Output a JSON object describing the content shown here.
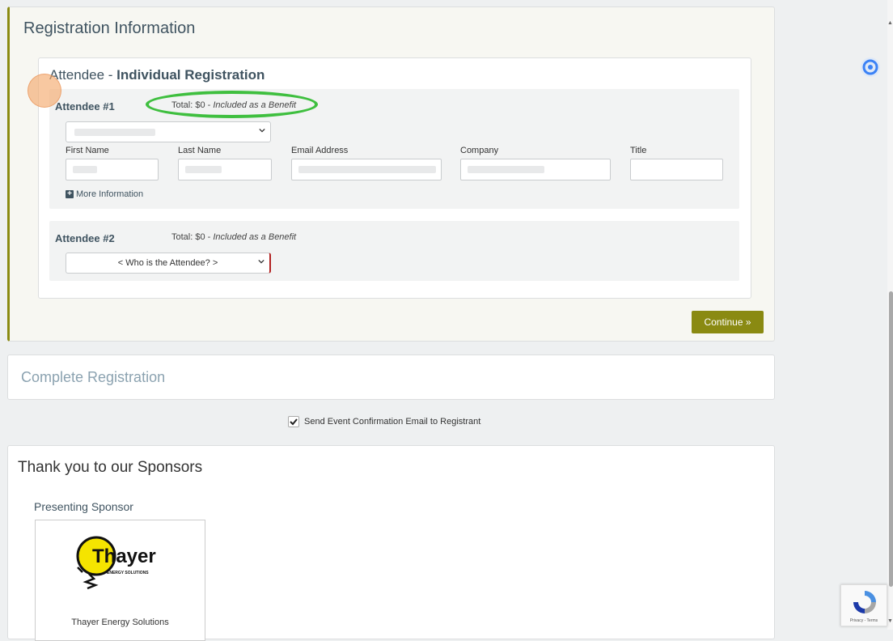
{
  "registration": {
    "title": "Registration Information",
    "card_heading_prefix": "Attendee - ",
    "card_heading_bold": "Individual Registration",
    "attendees": [
      {
        "label": "Attendee #1",
        "total_prefix": "Total: $0 - ",
        "total_note": "Included as a Benefit",
        "fields": [
          {
            "label": "First Name"
          },
          {
            "label": "Last Name"
          },
          {
            "label": "Email Address"
          },
          {
            "label": "Company"
          },
          {
            "label": "Title"
          }
        ],
        "more_info": "More Information"
      },
      {
        "label": "Attendee #2",
        "total_prefix": "Total: $0 - ",
        "total_note": "Included as a Benefit",
        "select_value": "< Who is the Attendee? >"
      }
    ],
    "continue_label": "Continue »"
  },
  "complete": {
    "title": "Complete Registration"
  },
  "confirmation": {
    "label": "Send Event Confirmation Email to Registrant",
    "checked": true
  },
  "sponsors": {
    "title": "Thank you to our Sponsors",
    "presenting_label": "Presenting Sponsor",
    "sponsor_name": "Thayer Energy Solutions",
    "logo_text": "Thayer",
    "logo_subtext": "ENERGY SOLUTIONS"
  },
  "recaptcha": {
    "text": "Privacy - Terms"
  },
  "colors": {
    "accent": "#8a8a12",
    "heading": "#3f5360",
    "annotation": "#3fbf3f"
  }
}
